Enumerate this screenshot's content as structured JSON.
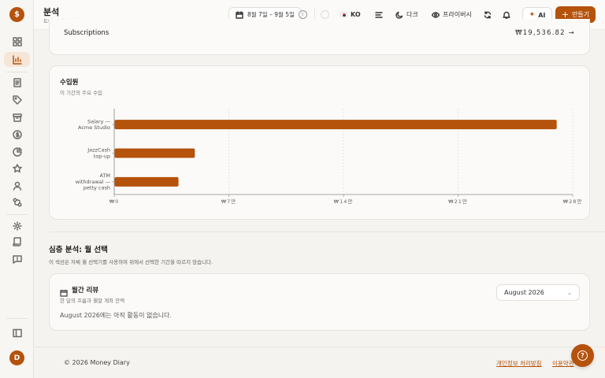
{
  "header": {
    "title": "분석",
    "subtitle": "트렌드 및 인사이트",
    "date_range": "8월 7일 – 9월 5일",
    "info_symbol": "i",
    "language": "KO",
    "theme": "다크",
    "privacy": "프라이버시",
    "ai": "AI",
    "ai_symbol": "✦",
    "create": "만들기",
    "create_symbol": "+"
  },
  "sidebar": {
    "logo": "$",
    "avatar": "D",
    "icons": [
      "dashboard-icon",
      "analytics-icon",
      "document-icon",
      "tag-icon",
      "archive-icon",
      "dollar-icon",
      "pie-icon",
      "star-icon",
      "user-icon",
      "integration-icon",
      "settings-icon",
      "script-icon",
      "feedback-icon",
      "panel-toggle-icon"
    ]
  },
  "subscriptions": {
    "label": "Subscriptions",
    "amount": "₩19,536.82"
  },
  "income": {
    "title": "수입원",
    "subtitle": "이 기간의 주요 수입"
  },
  "chart_data": {
    "type": "bar",
    "orientation": "horizontal",
    "title": "수입원",
    "categories": [
      [
        "Salary —",
        "Acme Studio"
      ],
      [
        "JazzCash",
        "top-up"
      ],
      [
        "ATM",
        "withdrawal —",
        "petty cash"
      ]
    ],
    "values": [
      2700000,
      490000,
      390000
    ],
    "xlim": [
      0,
      2800000
    ],
    "xticks": [
      0,
      700000,
      1400000,
      2100000,
      2800000
    ],
    "xtick_labels": [
      "₩0",
      "₩7만",
      "₩14만",
      "₩21만",
      "₩28만"
    ],
    "bar_color": "#b5520c",
    "grid": "vertical dashed"
  },
  "deep": {
    "title": "심층 분석: 월 선택",
    "subtitle": "이 섹션은 자체 월 선택기를 사용하며 위에서 선택한 기간을 따르지 않습니다."
  },
  "review": {
    "title": "월간 리뷰",
    "subtitle": "한 달의 흐름과 월말 계좌 잔액",
    "selected_month": "August 2026",
    "empty": "August 2026에는 아직 활동이 없습니다."
  },
  "footer": {
    "copyright": "© 2026 Money Diary",
    "privacy_link": "개인정보 처리방침",
    "terms_link": "이용약관",
    "help_symbol": "?"
  }
}
